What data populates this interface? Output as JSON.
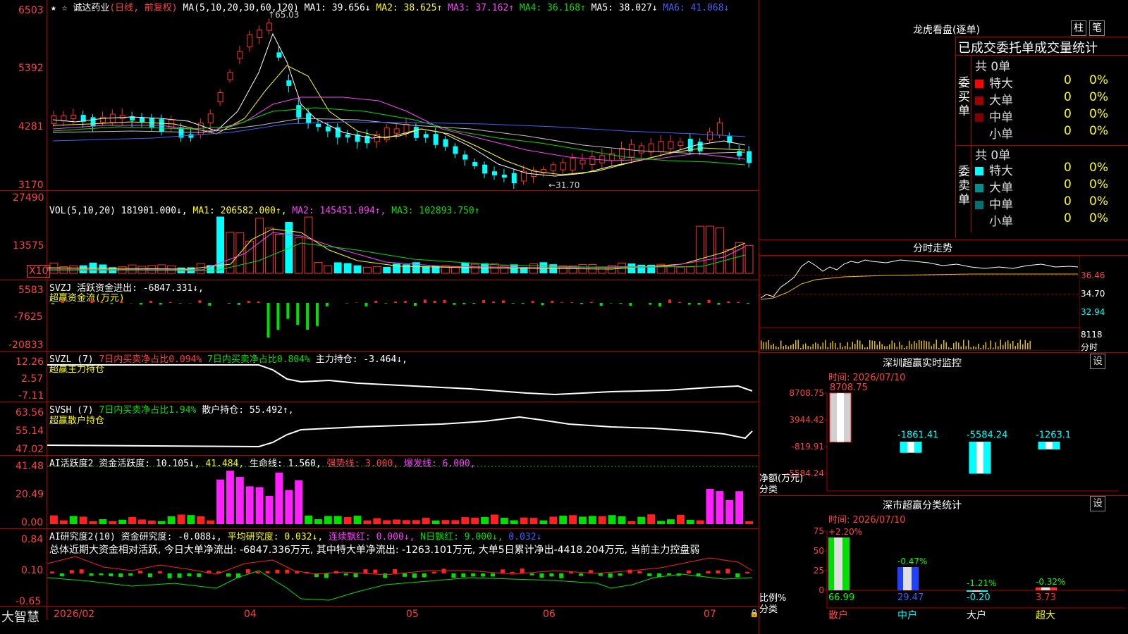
{
  "kline": {
    "header": {
      "stock_name": "诚达药业",
      "period_label": "(日线, 前复权)",
      "ma_params": "MA(5,10,20,30,60,120)",
      "ma1": "MA1: 39.656↓",
      "ma2": "MA2: 38.625↑",
      "ma3": "MA3: 37.162↑",
      "ma4": "MA4: 36.168↑",
      "ma5": "MA5: 38.027↓",
      "ma6": "MA6: 41.068↓"
    },
    "y_ticks": [
      "6503",
      "5392",
      "4281",
      "3170"
    ],
    "high_mark": "65.03",
    "low_mark": "←31.70",
    "colors": {
      "up": "#ff3030",
      "down": "#00ffff"
    }
  },
  "vol": {
    "header": "VOL(5,10,20)",
    "value": "181901.000↓,",
    "ma1": "MA1: 206582.000↑,",
    "ma2": "MA2: 145451.094↑,",
    "ma3": "MA3: 102893.750↑",
    "y_ticks": [
      "27490",
      "13575"
    ],
    "unit": "X10"
  },
  "svzj": {
    "header": "SVZJ  活跃资金进出: -6847.331↓,",
    "subtitle": "超赢资金流(万元)",
    "y_ticks": [
      "5583",
      "-7625",
      "-20833"
    ]
  },
  "svzl": {
    "header": "SVZL (7)",
    "part1": "7日内买卖净占比0.094%",
    "part2": "7日内买卖净占比0.804%",
    "part3": "主力持仓: -3.464↓,",
    "subtitle": "超赢主力持仓",
    "y_ticks": [
      "12.26",
      "2.57",
      "-7.11"
    ]
  },
  "svsh": {
    "header": "SVSH (7)",
    "part1": "7日内买卖净占比1.94%",
    "part2": "散户持仓: 55.492↑,",
    "subtitle": "超赢散户持仓",
    "y_ticks": [
      "63.56",
      "55.14",
      "47.02"
    ]
  },
  "ai_active": {
    "header": "AI活跃度2 资金活跃度: 10.105↓,",
    "v2": "41.484,",
    "life": "生命线: 1.560,",
    "strong": "强势线: 3.000,",
    "burst": "爆发线: 6.000,",
    "y_ticks": [
      "41.48",
      "20.49",
      "0.00"
    ]
  },
  "ai_research": {
    "header": "AI研究度2(10) 资金研究度: -0.088↓,",
    "avg": "平均研究度: 0.032↓,",
    "streak": "连续飘红: 0.000↓,",
    "nday": "N日飘红: 9.000↓,",
    "last": "0.032↓",
    "summary": "总体近期大资金相对活跃, 今日大单净流出: -6847.336万元, 其中特大单净流出: -1263.101万元, 大单5日累计净出-4418.204万元, 当前主力控盘弱",
    "y_ticks": [
      "0.84",
      "0.10",
      "-0.65"
    ]
  },
  "footer": {
    "brand": "大智慧",
    "dates": [
      "2026/02",
      "04",
      "05",
      "06",
      "07"
    ]
  },
  "right": {
    "dragon_title": "龙虎看盘(逐单)",
    "tab1": "柱",
    "tab2": "笔",
    "stat_title": "已成交委托单成交量统计",
    "buy_label": "委买单",
    "sell_label": "委卖单",
    "buy_total": "共 0单",
    "sell_total": "共 0单",
    "buy_rows": [
      {
        "name": "特大",
        "count": "0",
        "pct": "0%",
        "color": "#ff0000"
      },
      {
        "name": "大单",
        "count": "0",
        "pct": "0%",
        "color": "#a00000"
      },
      {
        "name": "中单",
        "count": "0",
        "pct": "0%",
        "color": "#800000"
      },
      {
        "name": "小单",
        "count": "0",
        "pct": "0%",
        "color": "#000000"
      }
    ],
    "sell_rows": [
      {
        "name": "特大",
        "count": "0",
        "pct": "0%",
        "color": "#00ffff"
      },
      {
        "name": "大单",
        "count": "0",
        "pct": "0%",
        "color": "#009090"
      },
      {
        "name": "中单",
        "count": "0",
        "pct": "0%",
        "color": "#007070"
      },
      {
        "name": "小单",
        "count": "0",
        "pct": "0%",
        "color": "#000000"
      }
    ],
    "intraday_title": "分时走势",
    "intraday_ticks": [
      "36.46",
      "34.70",
      "32.94",
      "8118",
      "分时"
    ],
    "monitor_title": "深圳超赢实时监控",
    "monitor_set": "设",
    "monitor_time": "时间: 2026/07/10",
    "monitor_y": [
      "8708.75",
      "3944.42",
      "-819.91",
      "-5584.24"
    ],
    "monitor_axis1": "净额(万元)",
    "monitor_axis2": "分类",
    "classify_title": "深市超赢分类统计",
    "classify_set": "设",
    "classify_time": "时间: 2026/07/10",
    "classify_y": [
      "75",
      "50",
      "25",
      "0"
    ],
    "classify_axis1": "比例%",
    "classify_axis2": "分类"
  },
  "chart_data": [
    {
      "type": "bar",
      "title": "深圳超赢实时监控",
      "ylabel": "净额(万元)",
      "xlabel": "分类",
      "categories": [
        "散户",
        "中户",
        "大户",
        "超大"
      ],
      "values": [
        8708.75,
        -1861.41,
        -5584.24,
        -1263.1
      ],
      "labels": [
        "8708.75",
        "-1861.41",
        "-5584.24",
        "-1263.1"
      ],
      "ylim": [
        -5584.24,
        8708.75
      ]
    },
    {
      "type": "bar",
      "title": "深市超赢分类统计",
      "ylabel": "比例%",
      "xlabel": "分类",
      "categories": [
        "散户",
        "中户",
        "大户",
        "超大"
      ],
      "values": [
        66.99,
        29.47,
        -0.2,
        3.73
      ],
      "labels": [
        "66.99",
        "29.47",
        "-0.20",
        "3.73"
      ],
      "changes": [
        "+2.20%",
        "-0.47%",
        "-1.21%",
        "-0.32%"
      ],
      "ylim": [
        0,
        75
      ]
    }
  ]
}
